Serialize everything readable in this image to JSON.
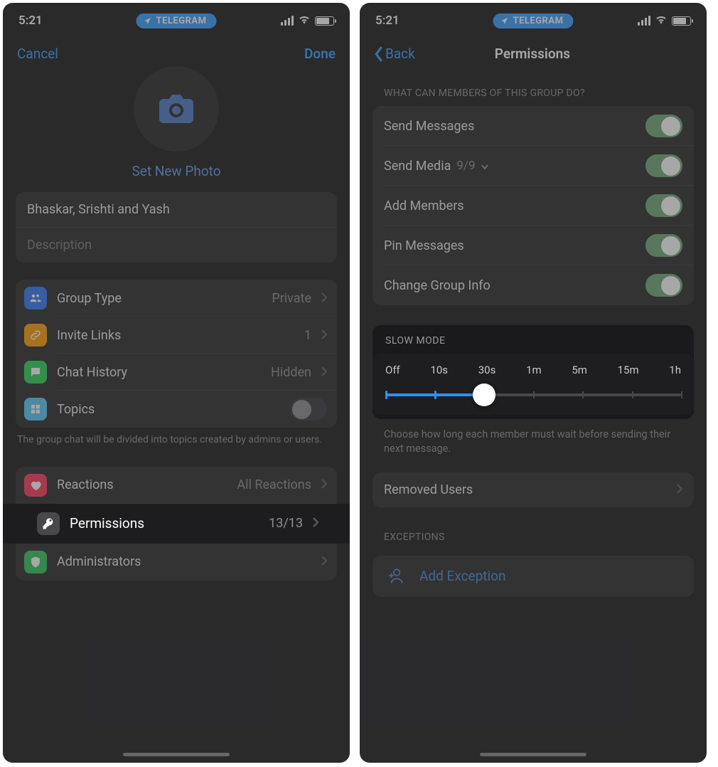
{
  "status": {
    "time": "5:21",
    "pill": "TELEGRAM"
  },
  "left": {
    "nav": {
      "cancel": "Cancel",
      "done": "Done"
    },
    "set_photo": "Set New Photo",
    "group_name": "Bhaskar, Srishti and Yash",
    "description_placeholder": "Description",
    "settings": {
      "group_type": {
        "label": "Group Type",
        "value": "Private"
      },
      "invite_links": {
        "label": "Invite Links",
        "value": "1"
      },
      "chat_history": {
        "label": "Chat History",
        "value": "Hidden"
      },
      "topics": {
        "label": "Topics"
      }
    },
    "topics_footer": "The group chat will be divided into topics created by admins or users.",
    "reactions": {
      "label": "Reactions",
      "value": "All Reactions"
    },
    "permissions": {
      "label": "Permissions",
      "value": "13/13"
    },
    "administrators": {
      "label": "Administrators"
    }
  },
  "right": {
    "nav": {
      "back": "Back",
      "title": "Permissions"
    },
    "section_what": "WHAT CAN MEMBERS OF THIS GROUP DO?",
    "perms": {
      "send_messages": "Send Messages",
      "send_media": "Send Media",
      "send_media_count": "9/9",
      "add_members": "Add Members",
      "pin_messages": "Pin Messages",
      "change_info": "Change Group Info"
    },
    "slow": {
      "header": "SLOW MODE",
      "labels": [
        "Off",
        "10s",
        "30s",
        "1m",
        "5m",
        "15m",
        "1h"
      ],
      "selected_index": 2,
      "caption": "Choose how long each member must wait before sending their next message."
    },
    "removed_users": "Removed Users",
    "exceptions_header": "EXCEPTIONS",
    "add_exception": "Add Exception"
  }
}
